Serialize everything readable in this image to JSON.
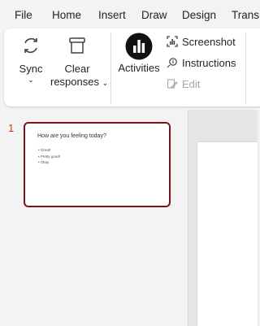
{
  "menu": {
    "items": [
      {
        "label": "File"
      },
      {
        "label": "Home"
      },
      {
        "label": "Insert"
      },
      {
        "label": "Draw"
      },
      {
        "label": "Design"
      },
      {
        "label": "Trans"
      }
    ]
  },
  "ribbon": {
    "sync": {
      "label": "Sync",
      "icon": "sync-icon"
    },
    "clear": {
      "label_line1": "Clear",
      "label_line2": "responses",
      "icon": "trash-icon"
    },
    "activities": {
      "label": "Activities",
      "icon": "activities-icon"
    },
    "screenshot": {
      "label": "Screenshot",
      "icon": "screenshot-icon"
    },
    "instructions": {
      "label": "Instructions",
      "icon": "instructions-icon"
    },
    "edit": {
      "label": "Edit",
      "icon": "edit-icon",
      "disabled": true
    }
  },
  "slides": {
    "thumbnails": [
      {
        "number": "1",
        "title": "How are you feeling today?",
        "bullets": [
          "Great!",
          "Pretty good!",
          "Okay"
        ]
      }
    ]
  },
  "colors": {
    "accent_border": "#7a1420",
    "slide_number": "#c43e1c",
    "ribbon_bg": "#ffffff",
    "app_bg": "#f3f3f3"
  }
}
